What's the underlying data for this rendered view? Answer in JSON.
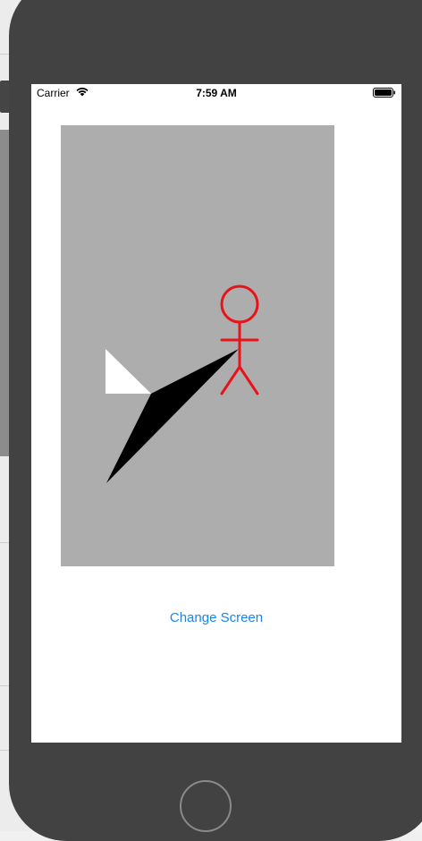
{
  "status_bar": {
    "carrier": "Carrier",
    "time": "7:59 AM",
    "wifi_icon": "wifi-icon",
    "battery_icon": "battery-full-icon"
  },
  "drawing_area": {
    "background": "#adadad",
    "stick_figure_color": "#e8141b",
    "sword_color": "#000000",
    "blade_tip_color": "#ffffff"
  },
  "change_screen_button": {
    "label": "Change Screen",
    "color": "#1a86e8"
  },
  "home_button": {
    "icon": "home-button-circle"
  }
}
